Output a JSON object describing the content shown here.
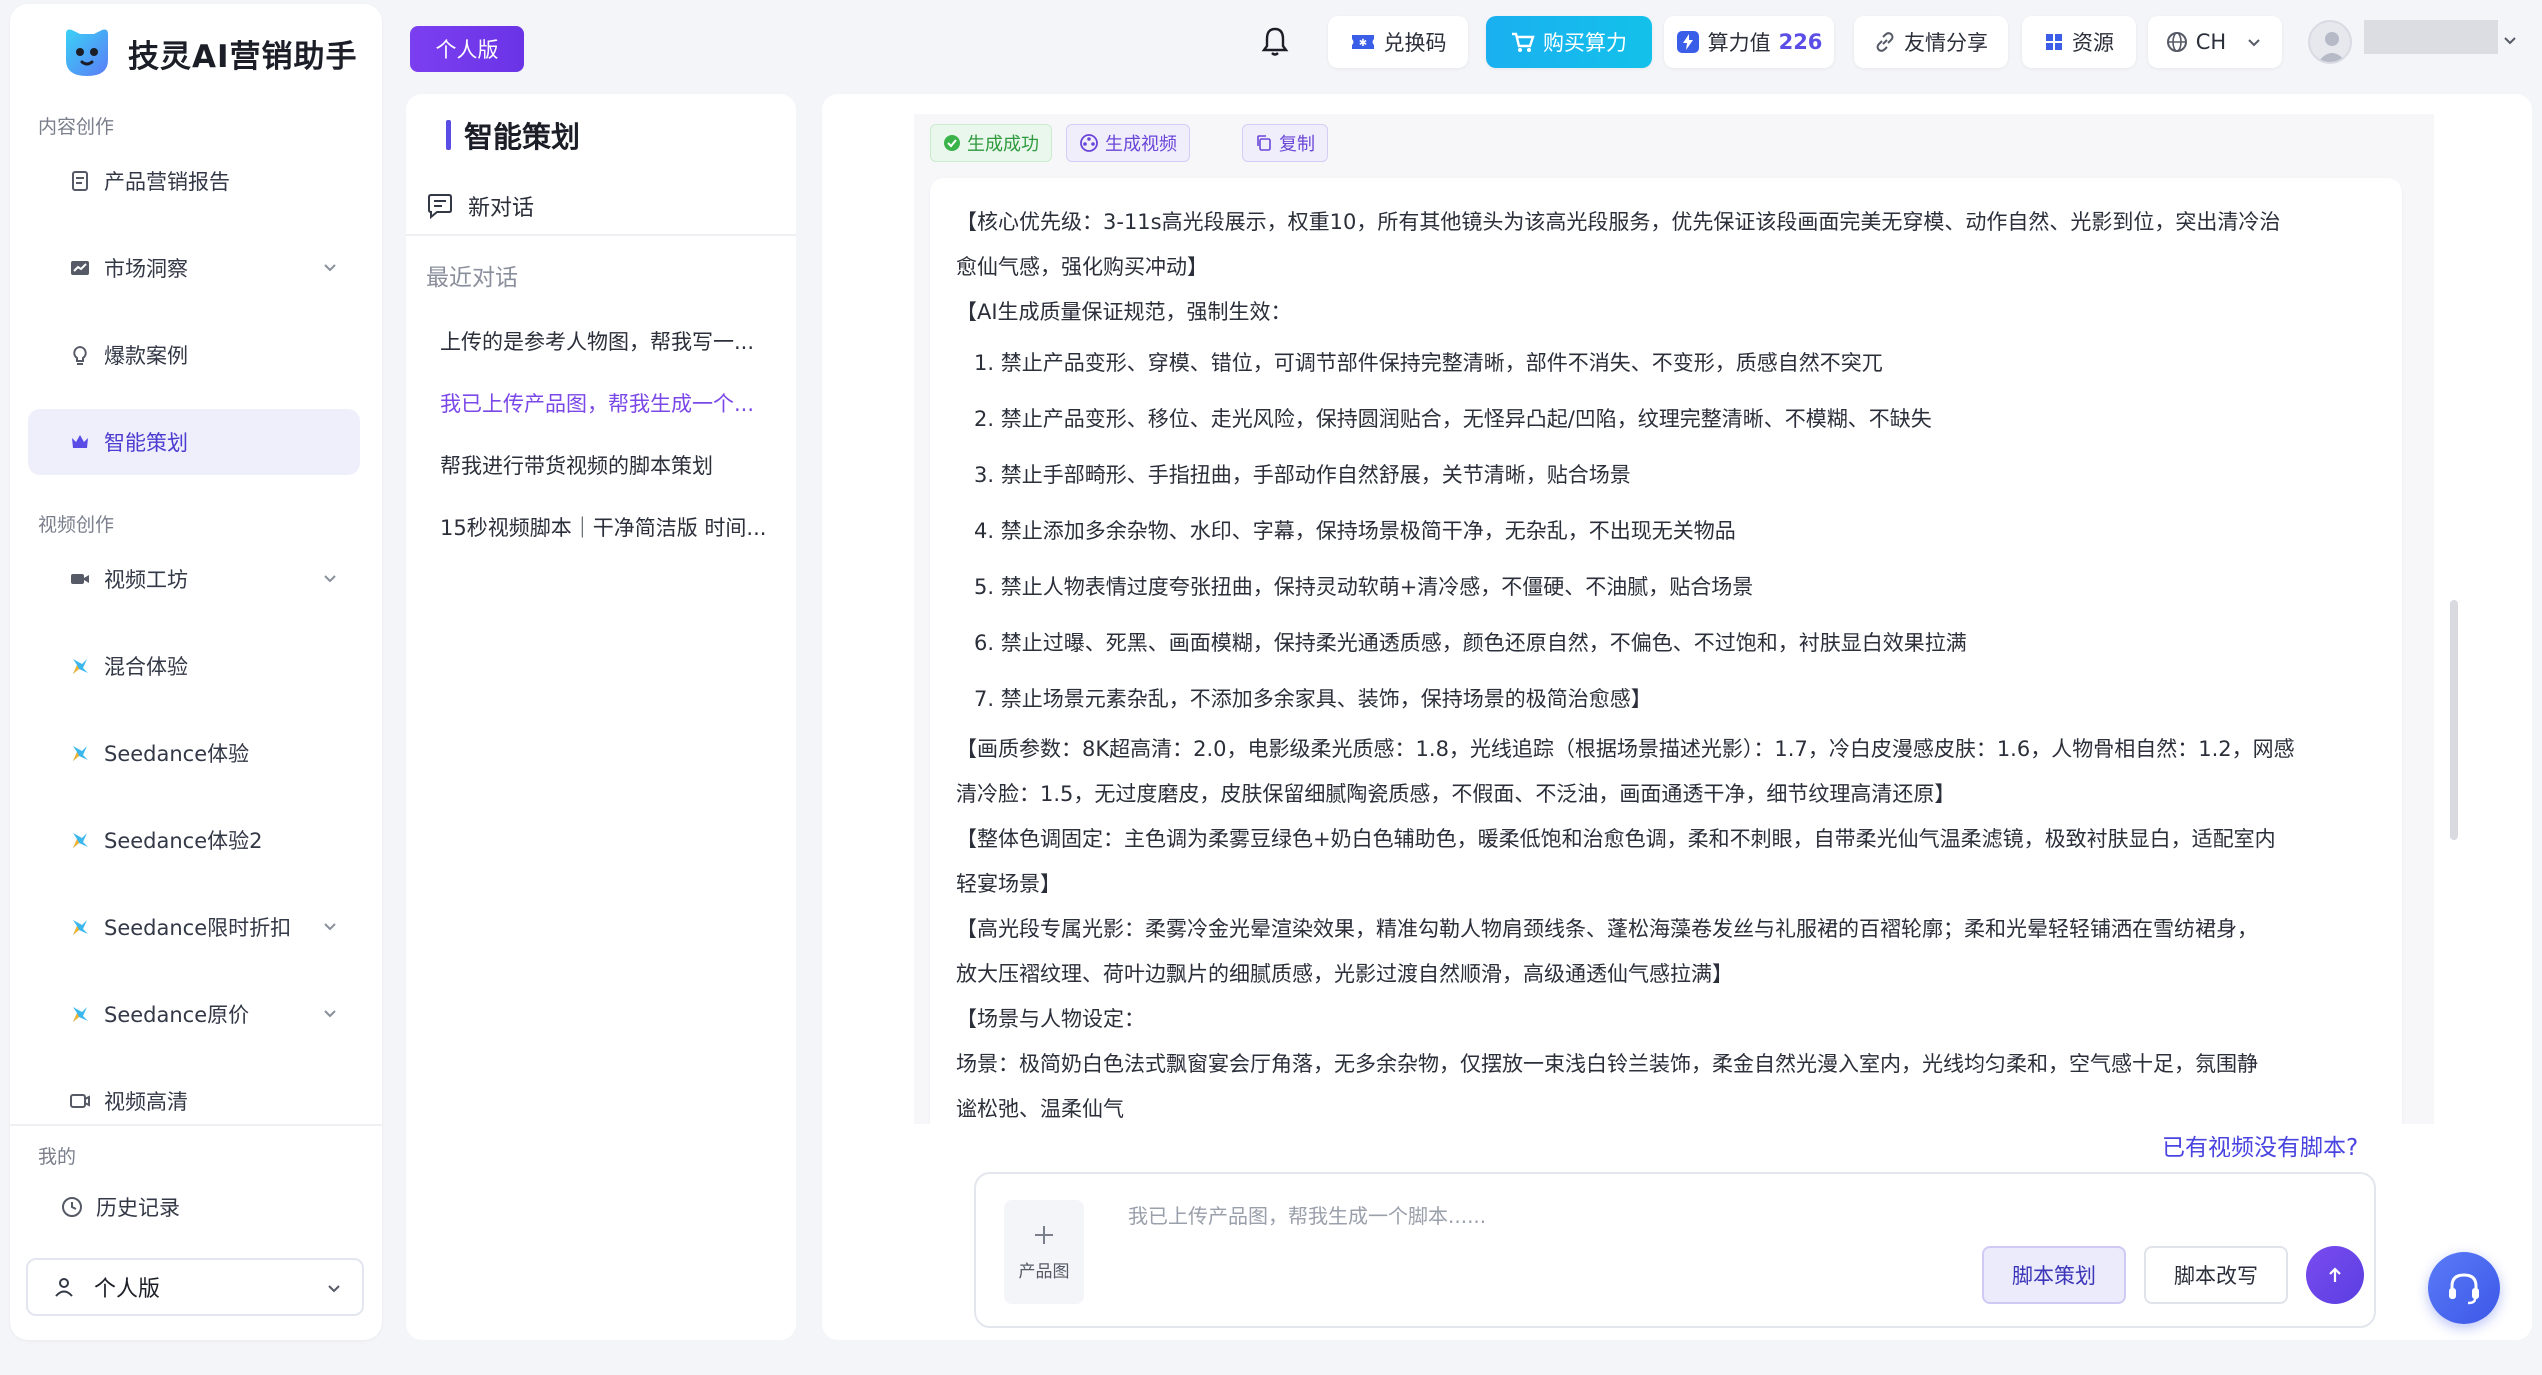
{
  "brand": {
    "name": "技灵AI营销助手"
  },
  "sidebar": {
    "section_content": "内容创作",
    "section_video": "视频创作",
    "section_mine": "我的",
    "items": [
      {
        "label": "产品营销报告"
      },
      {
        "label": "市场洞察"
      },
      {
        "label": "爆款案例"
      },
      {
        "label": "智能策划"
      },
      {
        "label": "视频工坊"
      },
      {
        "label": "混合体验"
      },
      {
        "label": "Seedance体验"
      },
      {
        "label": "Seedance体验2"
      },
      {
        "label": "Seedance限时折扣"
      },
      {
        "label": "Seedance原价"
      },
      {
        "label": "视频高清"
      }
    ],
    "history_label": "历史记录",
    "version_label": "个人版"
  },
  "header": {
    "plan_badge": "个人版",
    "redeem_label": "兑换码",
    "buy_label": "购买算力",
    "compute_label": "算力值",
    "compute_value": "226",
    "share_label": "友情分享",
    "resources_label": "资源",
    "language_label": "CH"
  },
  "conversations": {
    "title": "智能策划",
    "new_chat_label": "新对话",
    "recent_title": "最近对话",
    "items": [
      {
        "label": "上传的是参考人物图，帮我写一..."
      },
      {
        "label": "我已上传产品图，帮我生成一个..."
      },
      {
        "label": "帮我进行带货视频的脚本策划"
      },
      {
        "label": "15秒视频脚本｜干净简洁版 时间..."
      }
    ]
  },
  "message": {
    "tag_success": "生成成功",
    "tag_video": "生成视频",
    "tag_copy": "复制",
    "lines_intro": [
      "【核心优先级：3-11s高光段展示，权重10，所有其他镜头为该高光段服务，优先保证该段画面完美无穿模、动作自然、光影到位，突出清冷治",
      "愈仙气感，强化购买冲动】",
      "【AI生成质量保证规范，强制生效："
    ],
    "rules": [
      "1. 禁止产品变形、穿模、错位，可调节部件保持完整清晰，部件不消失、不变形，质感自然不突兀",
      "2. 禁止产品变形、移位、走光风险，保持圆润贴合，无怪异凸起/凹陷，纹理完整清晰、不模糊、不缺失",
      "3. 禁止手部畸形、手指扭曲，手部动作自然舒展，关节清晰，贴合场景",
      "4. 禁止添加多余杂物、水印、字幕，保持场景极简干净，无杂乱，不出现无关物品",
      "5. 禁止人物表情过度夸张扭曲，保持灵动软萌+清冷感，不僵硬、不油腻，贴合场景",
      "6. 禁止过曝、死黑、画面模糊，保持柔光通透质感，颜色还原自然，不偏色、不过饱和，衬肤显白效果拉满",
      "7. 禁止场景元素杂乱，不添加多余家具、装饰，保持场景的极简治愈感】"
    ],
    "lines_rest": [
      "【画质参数：8K超高清：2.0，电影级柔光质感：1.8，光线追踪（根据场景描述光影）：1.7，冷白皮漫感皮肤：1.6，人物骨相自然：1.2，网感",
      "清冷脸：1.5，无过度磨皮，皮肤保留细腻陶瓷质感，不假面、不泛油，画面通透干净，细节纹理高清还原】",
      "【整体色调固定：主色调为柔雾豆绿色+奶白色辅助色，暖柔低饱和治愈色调，柔和不刺眼，自带柔光仙气温柔滤镜，极致衬肤显白，适配室内",
      "轻宴场景】",
      "【高光段专属光影：柔雾冷金光晕渲染效果，精准勾勒人物肩颈线条、蓬松海藻卷发丝与礼服裙的百褶轮廓；柔和光晕轻轻铺洒在雪纺裙身，",
      "放大压褶纹理、荷叶边飘片的细腻质感，光影过渡自然顺滑，高级通透仙气感拉满】",
      "【场景与人物设定：",
      "场景：极简奶白色法式飘窗宴会厅角落，无多余杂物，仅摆放一束浅白铃兰装饰，柔金自然光漫入室内，光线均匀柔和，空气感十足，氛围静",
      "谧松弛、温柔仙气"
    ]
  },
  "composer": {
    "script_link": "已有视频没有脚本?",
    "upload_label": "产品图",
    "placeholder": "我已上传产品图，帮我生成一个脚本......",
    "plan_button": "脚本策划",
    "rewrite_button": "脚本改写"
  }
}
